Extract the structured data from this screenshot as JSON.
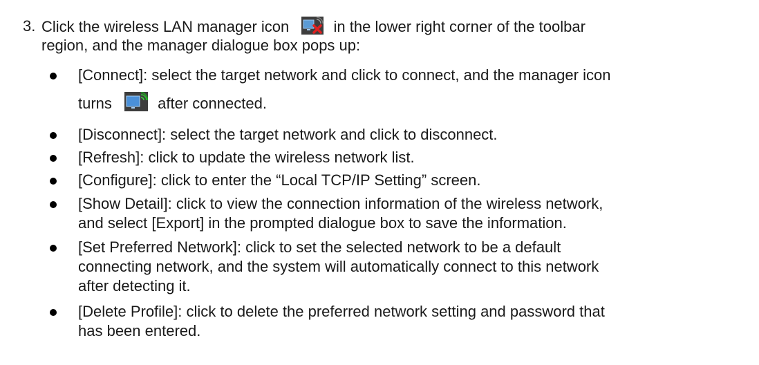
{
  "step": {
    "number": "3.",
    "line1_before_icon": "Click the wireless LAN manager icon",
    "line1_after_icon": "in the lower right corner of the toolbar",
    "line2": "region, and the manager dialogue box pops up:"
  },
  "icons": {
    "disconnected": "wireless-lan-manager-disconnected-icon",
    "connected": "wireless-lan-manager-connected-icon"
  },
  "bullets": [
    {
      "lines": [
        "[Connect]: select the target network and click to connect, and the manager icon"
      ],
      "line2_before_icon": "turns",
      "line2_after_icon": "after connected."
    },
    {
      "lines": [
        "[Disconnect]: select the target network and click to disconnect."
      ]
    },
    {
      "lines": [
        "[Refresh]: click to update the wireless network list."
      ]
    },
    {
      "lines": [
        "[Configure]: click to enter the “Local TCP/IP Setting” screen."
      ]
    },
    {
      "lines": [
        "[Show Detail]: click to view the connection information of the wireless network,",
        "and select [Export] in the prompted dialogue box to save the information."
      ]
    },
    {
      "lines": [
        "[Set Preferred Network]: click to set the selected network to be a default",
        "connecting network, and the system will automatically connect to this network",
        "after detecting it."
      ]
    },
    {
      "lines": [
        "[Delete Profile]: click to delete the preferred network setting and password that",
        "has been entered."
      ]
    }
  ]
}
